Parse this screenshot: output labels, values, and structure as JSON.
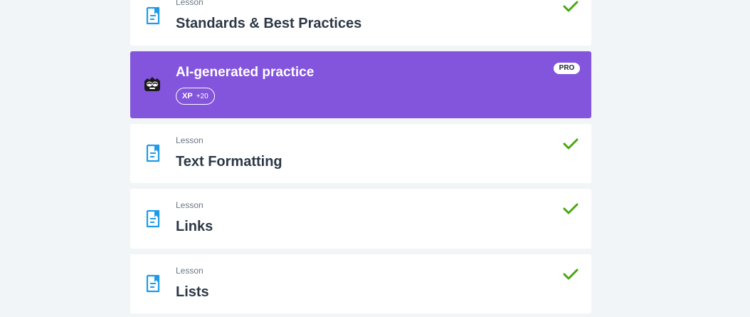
{
  "lessons": [
    {
      "type_label": "Lesson",
      "title": "Standards & Best Practices",
      "completed": true
    },
    {
      "type_label": "Lesson",
      "title": "Text Formatting",
      "completed": true
    },
    {
      "type_label": "Lesson",
      "title": "Links",
      "completed": true
    },
    {
      "type_label": "Lesson",
      "title": "Lists",
      "completed": true
    }
  ],
  "ai_practice": {
    "title": "AI-generated practice",
    "xp_label": "XP",
    "xp_value": "+20",
    "pro_badge": "PRO"
  },
  "colors": {
    "background": "#f2f5f7",
    "card": "#ffffff",
    "ai_card": "#8354dc",
    "doc_icon": "#1e9be8",
    "check": "#48a80f",
    "title_text": "#2d3846",
    "label_text": "#6b7785"
  },
  "icons": {
    "lesson": "document-icon",
    "completed": "checkmark-icon",
    "ai": "mascot-icon"
  }
}
